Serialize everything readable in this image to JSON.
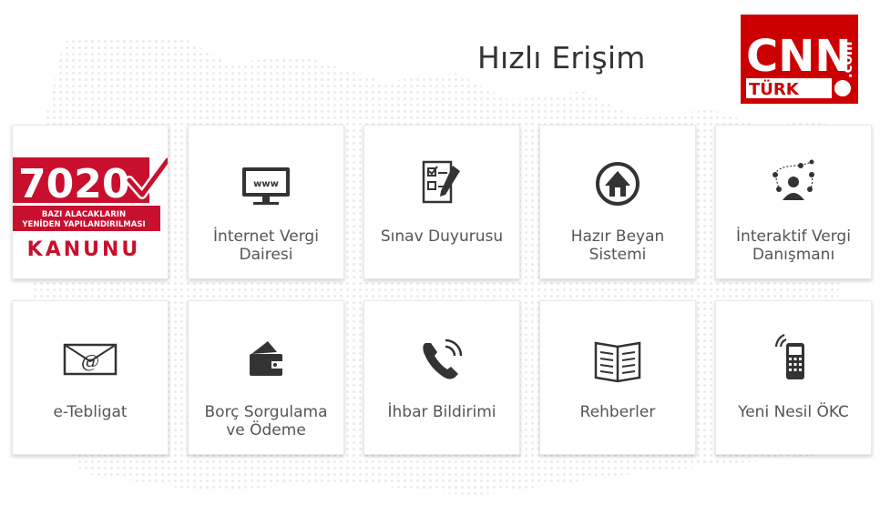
{
  "header": {
    "title": "Hızlı Erişim"
  },
  "brand": {
    "cnn_text": "CNN",
    "turk_text": "TÜRK",
    "com_text": ".com",
    "color": "#cc0000"
  },
  "promo": {
    "number": "7020",
    "line1": "BAZI ALACAKLARIN",
    "line2": "YENİDEN YAPILANDIRILMASI",
    "line3": "KANUNU",
    "color": "#c8102e"
  },
  "tiles": [
    {
      "id": "internet-vergi-dairesi",
      "label_lines": [
        "İnternet Vergi",
        "Dairesi"
      ],
      "icon": "monitor-www-icon"
    },
    {
      "id": "sinav-duyurusu",
      "label_lines": [
        "Sınav Duyurusu"
      ],
      "icon": "exam-checklist-icon"
    },
    {
      "id": "hazir-beyan-sistemi",
      "label_lines": [
        "Hazır Beyan",
        "Sistemi"
      ],
      "icon": "house-circle-icon"
    },
    {
      "id": "interaktif-vergi-danismani",
      "label_lines": [
        "İnteraktif Vergi",
        "Danışmanı"
      ],
      "icon": "advisor-network-icon"
    },
    {
      "id": "e-tebligat",
      "label_lines": [
        "e-Tebligat"
      ],
      "icon": "envelope-at-icon"
    },
    {
      "id": "borc-sorgulama-ve-odeme",
      "label_lines": [
        "Borç Sorgulama",
        "ve Ödeme"
      ],
      "icon": "wallet-card-icon"
    },
    {
      "id": "ihbar-bildirimi",
      "label_lines": [
        "İhbar Bildirimi"
      ],
      "icon": "phone-ringing-icon"
    },
    {
      "id": "rehberler",
      "label_lines": [
        "Rehberler"
      ],
      "icon": "open-book-icon"
    },
    {
      "id": "yeni-nesil-okc",
      "label_lines": [
        "Yeni Nesil ÖKC"
      ],
      "icon": "pos-terminal-icon"
    }
  ],
  "colors": {
    "icon": "#333333",
    "label": "#555555"
  }
}
